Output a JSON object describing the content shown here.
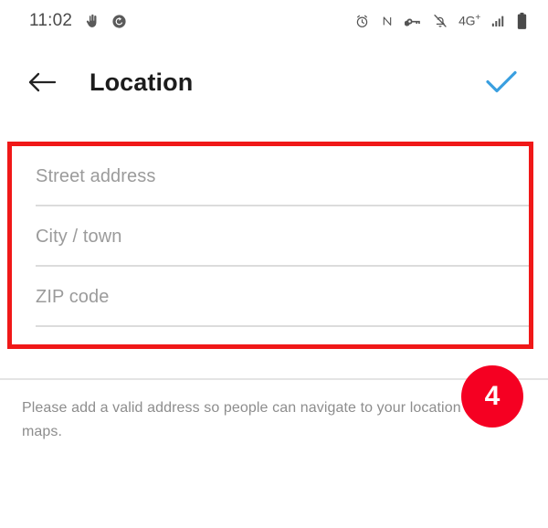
{
  "status_bar": {
    "time": "11:02",
    "left_icons": [
      "hand-touch-icon",
      "sync-refresh-icon"
    ],
    "right_icons": [
      "alarm-clock-icon",
      "nfc-icon",
      "vpn-key-icon",
      "notifications-off-icon"
    ],
    "network_type": "4G",
    "network_plus": "+",
    "signal_icon": "signal-bars-icon",
    "battery_icon": "battery-full-icon"
  },
  "app_bar": {
    "back_label": "back-arrow",
    "title": "Location",
    "confirm_label": "checkmark"
  },
  "form": {
    "fields": [
      {
        "placeholder": "Street address",
        "value": ""
      },
      {
        "placeholder": "City / town",
        "value": ""
      },
      {
        "placeholder": "ZIP code",
        "value": ""
      }
    ]
  },
  "helper": {
    "text": "Please add a valid address so people can navigate to your location in maps."
  },
  "badge": {
    "number": "4"
  },
  "colors": {
    "accent_blue": "#3a9fe0",
    "highlight_red": "#f01818",
    "badge_red": "#f50022",
    "placeholder_gray": "#9b9b9b",
    "helper_gray": "#8d8d8d"
  }
}
